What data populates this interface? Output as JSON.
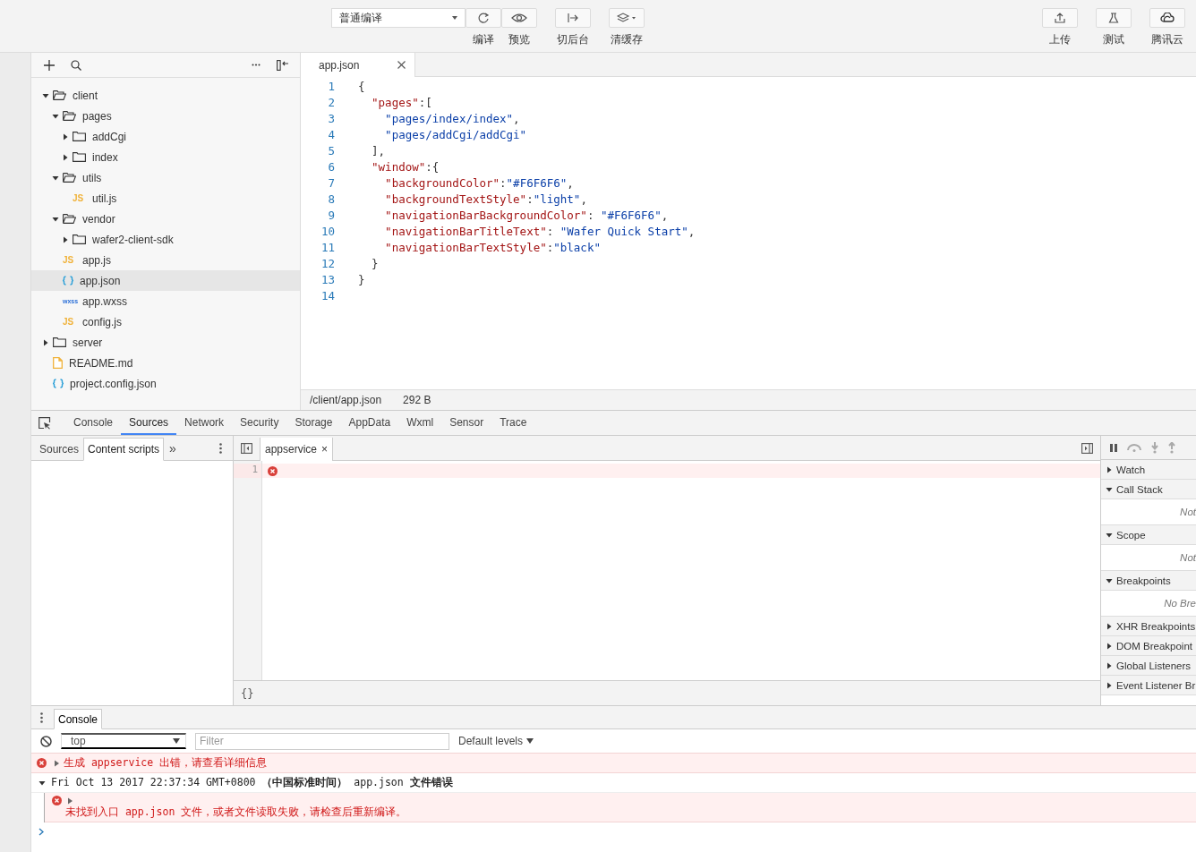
{
  "toolbar": {
    "compile_mode": "普通编译",
    "left_buttons": [
      {
        "kind": "refresh",
        "label": "编译"
      },
      {
        "kind": "eye",
        "label": "预览"
      },
      {
        "kind": "background",
        "label": "切后台"
      },
      {
        "kind": "layers",
        "label": "清缓存"
      }
    ],
    "right_buttons": [
      {
        "kind": "upload",
        "label": "上传"
      },
      {
        "kind": "flask",
        "label": "测试"
      },
      {
        "kind": "cloud",
        "label": "腾讯云"
      }
    ]
  },
  "file_tree": [
    {
      "name": "client",
      "kind": "folder",
      "expanded": true,
      "selected": false,
      "children": [
        {
          "name": "pages",
          "kind": "folder",
          "expanded": true,
          "selected": false,
          "children": [
            {
              "name": "addCgi",
              "kind": "folder",
              "expanded": false,
              "selected": false
            },
            {
              "name": "index",
              "kind": "folder",
              "expanded": false,
              "selected": false
            }
          ]
        },
        {
          "name": "utils",
          "kind": "folder",
          "expanded": true,
          "selected": false,
          "children": [
            {
              "name": "util.js",
              "kind": "js",
              "icon_text": "JS",
              "selected": false
            }
          ]
        },
        {
          "name": "vendor",
          "kind": "folder",
          "expanded": true,
          "selected": false,
          "children": [
            {
              "name": "wafer2-client-sdk",
              "kind": "folder",
              "expanded": false,
              "selected": false
            }
          ]
        },
        {
          "name": "app.js",
          "kind": "js",
          "icon_text": "JS",
          "selected": false
        },
        {
          "name": "app.json",
          "kind": "json",
          "selected": true
        },
        {
          "name": "app.wxss",
          "kind": "wxss",
          "icon_text": "wxss",
          "selected": false
        },
        {
          "name": "config.js",
          "kind": "js",
          "icon_text": "JS",
          "selected": false
        }
      ]
    },
    {
      "name": "server",
      "kind": "folder",
      "expanded": false,
      "selected": false
    },
    {
      "name": "README.md",
      "kind": "md",
      "selected": false
    },
    {
      "name": "project.config.json",
      "kind": "json",
      "selected": false
    }
  ],
  "editor": {
    "tab": "app.json",
    "lines": [
      {
        "number": "1",
        "tokens": [
          {
            "kind": "punct",
            "text": "{"
          }
        ]
      },
      {
        "number": "2",
        "tokens": [
          {
            "kind": "key",
            "text": "  \"pages\""
          },
          {
            "kind": "punct",
            "text": ":["
          }
        ]
      },
      {
        "number": "3",
        "tokens": [
          {
            "kind": "string",
            "text": "    \"pages/index/index\""
          },
          {
            "kind": "punct",
            "text": ","
          }
        ]
      },
      {
        "number": "4",
        "tokens": [
          {
            "kind": "string",
            "text": "    \"pages/addCgi/addCgi\""
          }
        ]
      },
      {
        "number": "5",
        "tokens": [
          {
            "kind": "punct",
            "text": "  ],"
          }
        ]
      },
      {
        "number": "6",
        "tokens": [
          {
            "kind": "key",
            "text": "  \"window\""
          },
          {
            "kind": "punct",
            "text": ":{"
          }
        ]
      },
      {
        "number": "7",
        "tokens": [
          {
            "kind": "key",
            "text": "    \"backgroundColor\""
          },
          {
            "kind": "punct",
            "text": ":"
          },
          {
            "kind": "string",
            "text": "\"#F6F6F6\""
          },
          {
            "kind": "punct",
            "text": ","
          }
        ]
      },
      {
        "number": "8",
        "tokens": [
          {
            "kind": "key",
            "text": "    \"backgroundTextStyle\""
          },
          {
            "kind": "punct",
            "text": ":"
          },
          {
            "kind": "string",
            "text": "\"light\""
          },
          {
            "kind": "punct",
            "text": ","
          }
        ]
      },
      {
        "number": "9",
        "tokens": [
          {
            "kind": "key",
            "text": "    \"navigationBarBackgroundColor\""
          },
          {
            "kind": "punct",
            "text": ": "
          },
          {
            "kind": "string",
            "text": "\"#F6F6F6\""
          },
          {
            "kind": "punct",
            "text": ","
          }
        ]
      },
      {
        "number": "10",
        "tokens": [
          {
            "kind": "key",
            "text": "    \"navigationBarTitleText\""
          },
          {
            "kind": "punct",
            "text": ": "
          },
          {
            "kind": "string",
            "text": "\"Wafer Quick Start\""
          },
          {
            "kind": "punct",
            "text": ","
          }
        ]
      },
      {
        "number": "11",
        "tokens": [
          {
            "kind": "key",
            "text": "    \"navigationBarTextStyle\""
          },
          {
            "kind": "punct",
            "text": ":"
          },
          {
            "kind": "string",
            "text": "\"black\""
          }
        ]
      },
      {
        "number": "12",
        "tokens": [
          {
            "kind": "punct",
            "text": "  }"
          }
        ]
      },
      {
        "number": "13",
        "tokens": [
          {
            "kind": "punct",
            "text": "}"
          }
        ]
      },
      {
        "number": "14"
      }
    ],
    "status_path": "/client/app.json",
    "status_size": "292 B"
  },
  "devtools": {
    "tabs": [
      {
        "label": "Console",
        "selected": false
      },
      {
        "label": "Sources",
        "selected": true
      },
      {
        "label": "Network",
        "selected": false
      },
      {
        "label": "Security",
        "selected": false
      },
      {
        "label": "Storage",
        "selected": false
      },
      {
        "label": "AppData",
        "selected": false
      },
      {
        "label": "Wxml",
        "selected": false
      },
      {
        "label": "Sensor",
        "selected": false
      },
      {
        "label": "Trace",
        "selected": false
      }
    ],
    "navigator_tabs": [
      {
        "label": "Sources",
        "selected": false
      },
      {
        "label": "Content scripts",
        "selected": true
      }
    ],
    "navigator_more": "»",
    "source_tab": "appservice",
    "source_tab_close": "×",
    "source_line": "1",
    "pretty_print": "{}",
    "sections": [
      {
        "title": "Watch",
        "expanded": false
      },
      {
        "title": "Call Stack",
        "expanded": true,
        "body": "Not"
      },
      {
        "title": "Scope",
        "expanded": true,
        "body": "Not"
      },
      {
        "title": "Breakpoints",
        "expanded": true,
        "body": "No Bre"
      },
      {
        "title": "XHR Breakpoints",
        "expanded": false
      },
      {
        "title": "DOM Breakpoint",
        "expanded": false
      },
      {
        "title": "Global Listeners",
        "expanded": false
      },
      {
        "title": "Event Listener Br",
        "expanded": false
      }
    ]
  },
  "console": {
    "tab": "Console",
    "context": "top",
    "filter_placeholder": "Filter",
    "levels": "Default levels",
    "messages": [
      {
        "kind": "error",
        "text": "生成 appservice 出错，请查看详细信息"
      },
      {
        "kind": "group",
        "expanded": true,
        "text": "Fri Oct 13 2017 22:37:34 GMT+0800 **（中国标准时间）** app.json **文件错误**",
        "children": [
          {
            "kind": "error",
            "text": "未找到入口 app.json 文件，或者文件读取失败，请检查后重新编译。"
          }
        ]
      }
    ]
  }
}
